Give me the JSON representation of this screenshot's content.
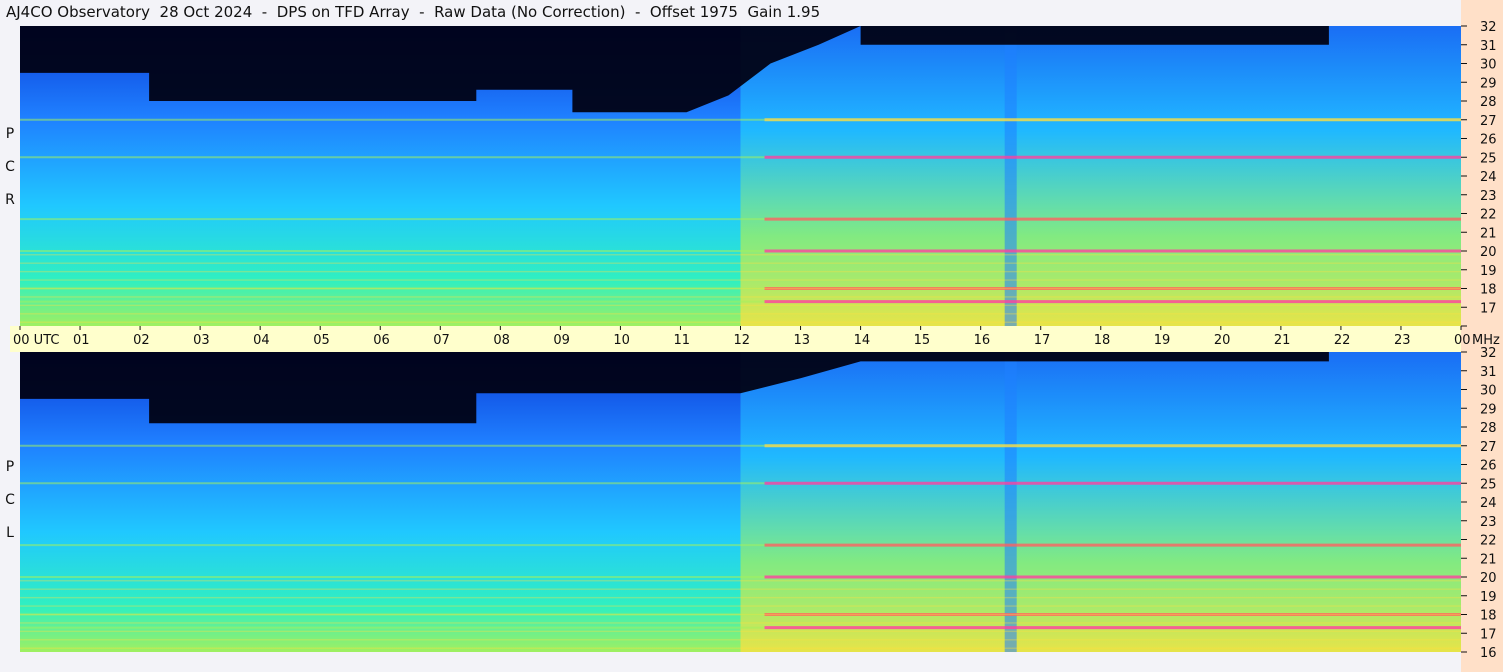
{
  "title": "AJ4CO Observatory  28 Oct 2024  -  DPS on TFD Array  -  Raw Data (No Correction)  -  Offset 1975  Gain 1.95",
  "panels": [
    {
      "label_letters": [
        "R",
        "C",
        "P"
      ]
    },
    {
      "label_letters": [
        "L",
        "C",
        "P"
      ]
    }
  ],
  "colors": {
    "background": "#f3f3f8",
    "time_axis_bar": "#ffffcc",
    "freq_axis_bar": "#ffe0c8",
    "colormap": [
      "#000010",
      "#001a66",
      "#0a3ad6",
      "#1f7fff",
      "#20c8ff",
      "#30f0c0",
      "#a0f060",
      "#ffe040",
      "#ff6060",
      "#ff40a0"
    ]
  },
  "chart_data": {
    "type": "heatmap",
    "description_kind": "dynamic spectrogram",
    "x": {
      "unit": "UTC",
      "range": [
        0,
        24
      ],
      "tick_labels": [
        "00 UTC",
        "01",
        "02",
        "03",
        "04",
        "05",
        "06",
        "07",
        "08",
        "09",
        "10",
        "11",
        "12",
        "13",
        "14",
        "15",
        "16",
        "17",
        "18",
        "19",
        "20",
        "21",
        "22",
        "23",
        "00"
      ]
    },
    "y": {
      "unit": "MHz",
      "range": [
        16,
        32
      ],
      "tick_labels": [
        "32",
        "31",
        "30",
        "29",
        "28",
        "27",
        "26",
        "25",
        "24",
        "23",
        "22",
        "21",
        "20",
        "19",
        "18",
        "17",
        "16"
      ],
      "top_label": "MHz"
    },
    "series": [
      {
        "name": "RCP",
        "night_cutoff_mhz": [
          [
            0,
            29.5
          ],
          [
            2.15,
            29.5
          ],
          [
            2.15,
            28.0
          ],
          [
            7.6,
            28.0
          ],
          [
            7.6,
            28.6
          ],
          [
            9.2,
            28.6
          ],
          [
            9.2,
            27.4
          ],
          [
            11.1,
            27.4
          ],
          [
            11.8,
            28.3
          ],
          [
            12.5,
            30.0
          ],
          [
            13.3,
            31.0
          ],
          [
            14.0,
            32.0
          ],
          [
            14.0,
            31.0
          ],
          [
            21.8,
            31.0
          ],
          [
            21.8,
            32.0
          ],
          [
            24,
            32.0
          ]
        ],
        "active_bands_mhz": [
          27.0,
          25.0,
          21.7,
          20.0,
          18.0,
          17.3
        ]
      },
      {
        "name": "LCP",
        "night_cutoff_mhz": [
          [
            0,
            29.5
          ],
          [
            2.15,
            29.5
          ],
          [
            2.15,
            28.2
          ],
          [
            7.6,
            28.2
          ],
          [
            7.6,
            29.8
          ],
          [
            12.0,
            29.8
          ],
          [
            13.0,
            30.6
          ],
          [
            14.0,
            31.5
          ],
          [
            21.8,
            31.5
          ],
          [
            21.8,
            32.0
          ],
          [
            24,
            32.0
          ]
        ],
        "active_bands_mhz": [
          27.0,
          25.0,
          21.7,
          20.0,
          18.0,
          17.3
        ]
      }
    ]
  }
}
